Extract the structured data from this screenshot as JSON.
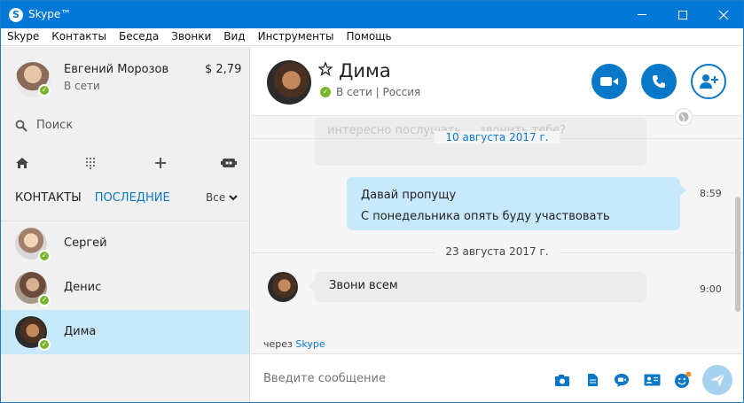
{
  "window": {
    "title": "Skype™"
  },
  "menu": [
    "Skype",
    "Контакты",
    "Беседа",
    "Звонки",
    "Вид",
    "Инструменты",
    "Помощь"
  ],
  "profile": {
    "name": "Евгений Морозов",
    "status": "В сети",
    "credit": "$ 2,79"
  },
  "search": {
    "label": "Поиск"
  },
  "tabs": {
    "contacts": "КОНТАКТЫ",
    "recent": "ПОСЛЕДНИЕ",
    "filter": "Все"
  },
  "contacts": [
    {
      "name": "Сергей"
    },
    {
      "name": "Денис"
    },
    {
      "name": "Дима"
    }
  ],
  "chat": {
    "name": "Дима",
    "status": "В сети | Россия",
    "ghost_text": "интересно послушать ... звонить тебе?",
    "date1": "10 августа 2017 г.",
    "out_line1": "Давай пропущу",
    "out_line2": "С понедельника опять буду участвовать",
    "out_time": "8:59",
    "date2": "23 августа 2017 г.",
    "in_text": "Звони всем",
    "in_time": "9:00",
    "via_prefix": "через",
    "via_brand": "Skype",
    "composer_placeholder": "Введите сообщение"
  },
  "colors": {
    "accent": "#0078d7",
    "online": "#7ab42a",
    "selected_row": "#c8e9fb"
  }
}
